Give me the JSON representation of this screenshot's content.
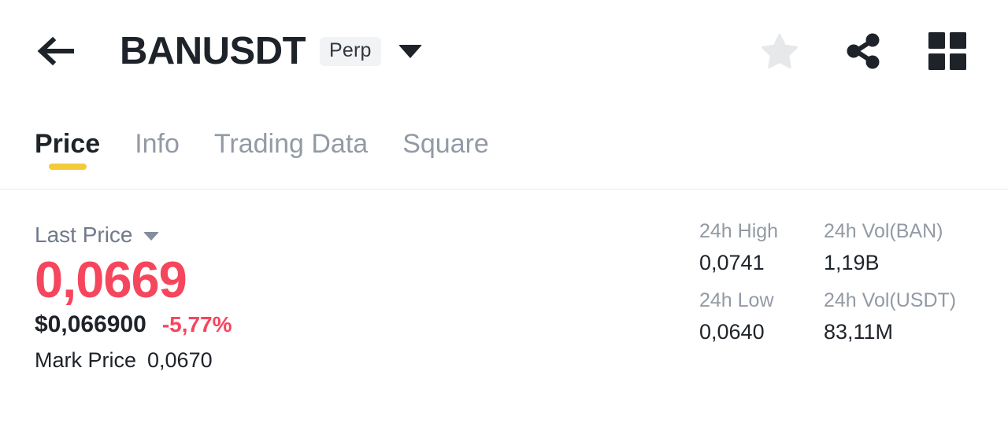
{
  "header": {
    "back_icon": "back-arrow-icon",
    "pair": "BANUSDT",
    "contract_badge": "Perp",
    "dropdown_icon": "chevron-down-icon",
    "favorite_icon": "star-icon",
    "share_icon": "share-icon",
    "grid_icon": "grid-icon"
  },
  "tabs": [
    {
      "label": "Price",
      "active": true
    },
    {
      "label": "Info",
      "active": false
    },
    {
      "label": "Trading Data",
      "active": false
    },
    {
      "label": "Square",
      "active": false
    }
  ],
  "price": {
    "selector_label": "Last Price",
    "selector_icon": "caret-down-icon",
    "last_price": "0,0669",
    "fiat_price": "$0,066900",
    "change_percent": "-5,77%",
    "mark_price_label": "Mark Price",
    "mark_price_value": "0,0670"
  },
  "stats": [
    {
      "label": "24h High",
      "value": "0,0741"
    },
    {
      "label": "24h Vol(BAN)",
      "value": "1,19B"
    },
    {
      "label": "24h Low",
      "value": "0,0640"
    },
    {
      "label": "24h Vol(USDT)",
      "value": "83,11M"
    }
  ],
  "colors": {
    "down_red": "#F6465D",
    "accent_yellow": "#F3CB3A",
    "text_primary": "#1E2329",
    "text_secondary": "#929AA5",
    "divider": "#EAECEF",
    "badge_bg": "#F2F3F5",
    "star_gray": "#E6E8EA"
  }
}
